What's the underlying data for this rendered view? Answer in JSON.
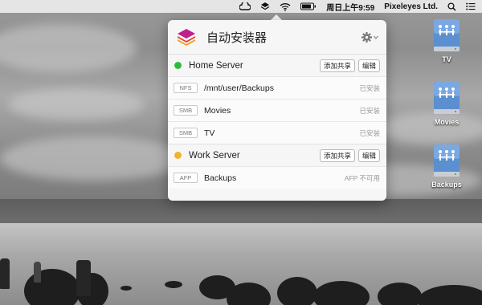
{
  "menubar": {
    "clock": "周日上午9:59",
    "user": "Pixeleyes Ltd."
  },
  "desktop": {
    "drives": [
      {
        "label": "TV"
      },
      {
        "label": "Movies"
      },
      {
        "label": "Backups"
      }
    ]
  },
  "popover": {
    "app_title": "自动安装器",
    "servers": [
      {
        "name": "Home Server",
        "status_color": "#2dbb3f",
        "add_share_label": "添加共享",
        "edit_label": "编辑",
        "shares": [
          {
            "protocol": "NFS",
            "path": "/mnt/user/Backups",
            "status": "已安装"
          },
          {
            "protocol": "SMB",
            "path": "Movies",
            "status": "已安装"
          },
          {
            "protocol": "SMB",
            "path": "TV",
            "status": "已安装"
          }
        ]
      },
      {
        "name": "Work Server",
        "status_color": "#f2b22b",
        "add_share_label": "添加共享",
        "edit_label": "编辑",
        "shares": [
          {
            "protocol": "AFP",
            "path": "Backups",
            "status": "AFP 不可用"
          }
        ]
      }
    ]
  },
  "icons": {
    "menubar": [
      "creative-cloud-icon",
      "app-stack-icon",
      "wifi-icon",
      "battery-icon",
      "spotlight-search-icon",
      "notification-list-icon"
    ],
    "popover": [
      "app-logo-icon",
      "gear-icon",
      "chevron-down-icon"
    ],
    "desktop": [
      "network-drive-icon"
    ]
  }
}
